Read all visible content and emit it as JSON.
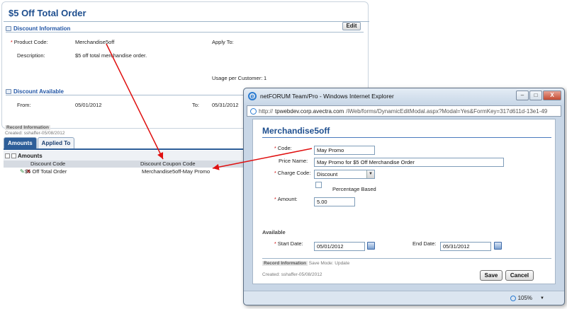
{
  "page": {
    "title": "$5 Off Total Order",
    "edit_label": "Edit",
    "discount_info": {
      "header": "Discount Information",
      "product_code_label": "Product Code:",
      "product_code_value": "Merchandise5off",
      "apply_to_label": "Apply To:",
      "description_label": "Description:",
      "description_value": "$5 off total merchandise order.",
      "usage_label": "Usage per Customer:",
      "usage_value": "1"
    },
    "discount_available": {
      "header": "Discount Available",
      "from_label": "From:",
      "from_value": "05/01/2012",
      "to_label": "To:",
      "to_value": "05/31/2012"
    },
    "record_info": {
      "title": "Record Information",
      "created": "Created: sshaffer-05/08/2012"
    },
    "tabs": [
      {
        "label": "Amounts",
        "active": true
      },
      {
        "label": "Applied To",
        "active": false
      }
    ],
    "grid": {
      "title": "Amounts",
      "headers": [
        "Discount Code",
        "Discount Coupon Code"
      ],
      "rows": [
        {
          "discount_code": "$5 Off Total Order",
          "coupon_code": "Merchandise5off-May Promo"
        }
      ]
    }
  },
  "modal": {
    "window_title": "netFORUM Team/Pro - Windows Internet Explorer",
    "url_prefix": "http://",
    "url_host": "tpwebdev.corp.avectra.com",
    "url_path": "/iWeb/forms/DynamicEditModal.aspx?Modal=Yes&FormKey=317d611d-13e1-49",
    "heading": "Merchandise5off",
    "code_label": "Code:",
    "code_value": "May Promo",
    "price_name_label": "Price Name:",
    "price_name_value": "May Promo for $5 Off Merchandise Order",
    "charge_code_label": "Charge Code:",
    "charge_code_value": "Discount",
    "percentage_based_label": "Percentage Based",
    "amount_label": "Amount:",
    "amount_value": "5.00",
    "available_label": "Available",
    "start_date_label": "Start Date:",
    "start_date_value": "05/01/2012",
    "end_date_label": "End Date:",
    "end_date_value": "05/31/2012",
    "record_info_title": "Record Information",
    "save_mode_label": "Save Mode: Update",
    "created": "Created: sshaffer-05/08/2012",
    "save_label": "Save",
    "cancel_label": "Cancel",
    "zoom": "105%",
    "window_buttons": {
      "minimize": "–",
      "maximize": "□",
      "close": "X"
    }
  },
  "colors": {
    "accent": "#1f4f8f",
    "annotation_arrow": "#e01010",
    "tab_active": "#2d5e99"
  }
}
